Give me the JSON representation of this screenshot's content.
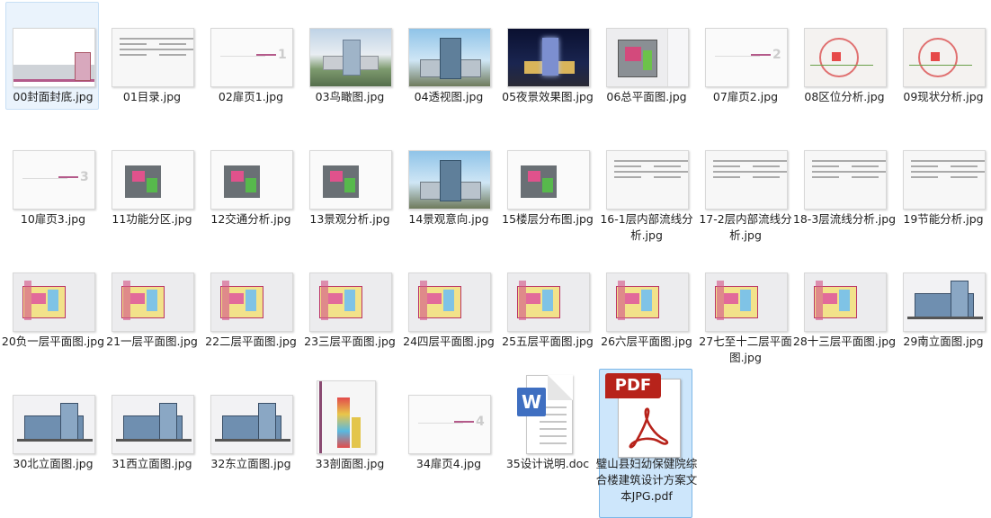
{
  "files": [
    {
      "name": "00封面封底.jpg",
      "thumb": "cover",
      "state": "hover"
    },
    {
      "name": "01目录.jpg",
      "thumb": "list"
    },
    {
      "name": "02扉页1.jpg",
      "thumb": "blank",
      "mark": "1"
    },
    {
      "name": "03鸟瞰图.jpg",
      "thumb": "photo"
    },
    {
      "name": "04透视图.jpg",
      "thumb": "view"
    },
    {
      "name": "05夜景效果图.jpg",
      "thumb": "night"
    },
    {
      "name": "06总平面图.jpg",
      "thumb": "plan"
    },
    {
      "name": "07扉页2.jpg",
      "thumb": "blank",
      "mark": "2"
    },
    {
      "name": "08区位分析.jpg",
      "thumb": "dist"
    },
    {
      "name": "09现状分析.jpg",
      "thumb": "dist"
    },
    {
      "name": "10扉页3.jpg",
      "thumb": "blank",
      "mark": "3"
    },
    {
      "name": "11功能分区.jpg",
      "thumb": "func"
    },
    {
      "name": "12交通分析.jpg",
      "thumb": "func"
    },
    {
      "name": "13景观分析.jpg",
      "thumb": "func"
    },
    {
      "name": "14景观意向.jpg",
      "thumb": "view"
    },
    {
      "name": "15楼层分布图.jpg",
      "thumb": "func"
    },
    {
      "name": "16-1层内部流线分析.jpg",
      "thumb": "list"
    },
    {
      "name": "17-2层内部流线分析.jpg",
      "thumb": "list"
    },
    {
      "name": "18-3层流线分析.jpg",
      "thumb": "list"
    },
    {
      "name": "19节能分析.jpg",
      "thumb": "list"
    },
    {
      "name": "20负一层平面图.jpg",
      "thumb": "floor"
    },
    {
      "name": "21一层平面图.jpg",
      "thumb": "floor"
    },
    {
      "name": "22二层平面图.jpg",
      "thumb": "floor"
    },
    {
      "name": "23三层平面图.jpg",
      "thumb": "floor"
    },
    {
      "name": "24四层平面图.jpg",
      "thumb": "floor"
    },
    {
      "name": "25五层平面图.jpg",
      "thumb": "floor"
    },
    {
      "name": "26六层平面图.jpg",
      "thumb": "floor"
    },
    {
      "name": "27七至十二层平面图.jpg",
      "thumb": "floor"
    },
    {
      "name": "28十三层平面图.jpg",
      "thumb": "floor"
    },
    {
      "name": "29南立面图.jpg",
      "thumb": "elev"
    },
    {
      "name": "30北立面图.jpg",
      "thumb": "elev"
    },
    {
      "name": "31西立面图.jpg",
      "thumb": "elev"
    },
    {
      "name": "32东立面图.jpg",
      "thumb": "elev"
    },
    {
      "name": "33剖面图.jpg",
      "thumb": "section"
    },
    {
      "name": "34扉页4.jpg",
      "thumb": "blank",
      "mark": "4"
    },
    {
      "name": "35设计说明.doc",
      "thumb": "doc",
      "badge": "W"
    },
    {
      "name": "璧山县妇幼保健院综合楼建筑设计方案文本JPG.pdf",
      "thumb": "pdf",
      "badge": "PDF",
      "state": "selected"
    }
  ]
}
